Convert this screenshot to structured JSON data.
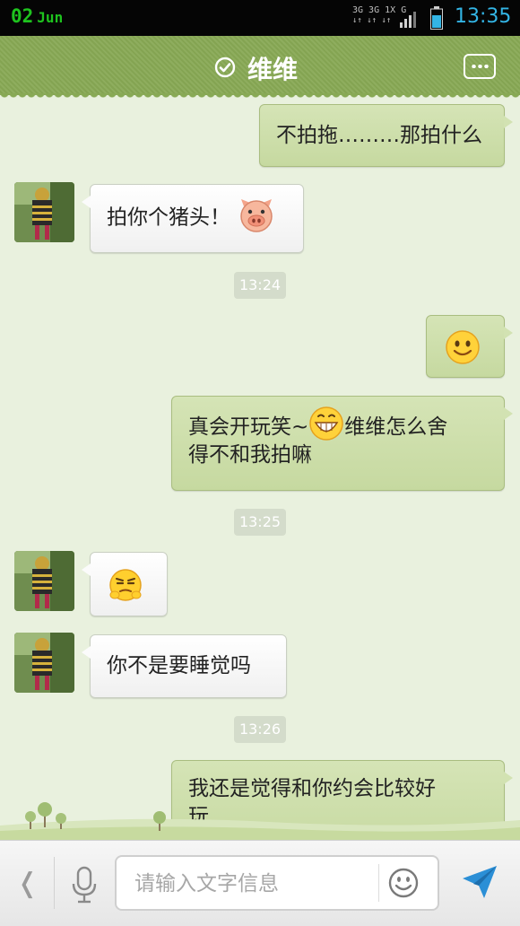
{
  "status_bar": {
    "date_day": "02",
    "date_month": "Jun",
    "network": "3G 3G 1X",
    "network_g": "G",
    "time": "13:35"
  },
  "header": {
    "title": "维维"
  },
  "messages": [
    {
      "side": "out",
      "text": "不拍拖………那拍什么"
    },
    {
      "side": "in",
      "text": "拍你个猪头！",
      "emoji": "pig-face-icon"
    },
    {
      "type": "time",
      "text": "13:24"
    },
    {
      "side": "out",
      "emoji": "smile-face-icon"
    },
    {
      "side": "out",
      "text_a": "真会开玩笑~",
      "emoji": "grin-face-icon",
      "text_b": "维维怎么舍",
      "text_c": "得不和我拍嘛"
    },
    {
      "type": "time",
      "text": "13:25"
    },
    {
      "side": "in",
      "emoji": "smug-face-icon"
    },
    {
      "side": "in",
      "text": "你不是要睡觉吗"
    },
    {
      "type": "time",
      "text": "13:26"
    },
    {
      "side": "out",
      "text_a": "我还是觉得和你约会比较好",
      "text_b": "玩"
    }
  ],
  "input_bar": {
    "back_glyph": "❬",
    "placeholder": "请输入文字信息"
  },
  "colors": {
    "header_green": "#88a955",
    "bubble_out": "#cadcA6",
    "bubble_in": "#ffffff",
    "send_blue": "#2b8fd6"
  }
}
